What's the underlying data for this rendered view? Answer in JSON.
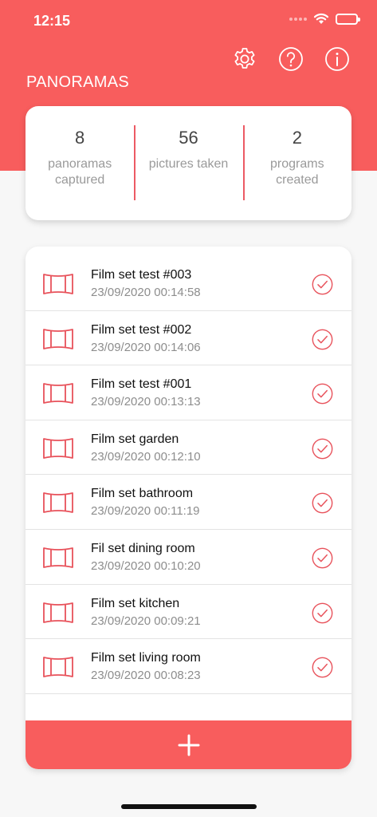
{
  "status_bar": {
    "time": "12:15"
  },
  "header": {
    "title": "PANORAMAS",
    "actions": [
      {
        "name": "settings-icon"
      },
      {
        "name": "help-icon"
      },
      {
        "name": "info-icon"
      }
    ]
  },
  "stats": [
    {
      "value": "8",
      "label": "panoramas captured"
    },
    {
      "value": "56",
      "label": "pictures taken"
    },
    {
      "value": "2",
      "label": "programs created"
    }
  ],
  "panoramas": [
    {
      "title": "Film set test #003",
      "date": "23/09/2020 00:14:58",
      "status": "check"
    },
    {
      "title": "Film set test #002",
      "date": "23/09/2020 00:14:06",
      "status": "check"
    },
    {
      "title": "Film set test #001",
      "date": "23/09/2020 00:13:13",
      "status": "check"
    },
    {
      "title": "Film set garden",
      "date": "23/09/2020 00:12:10",
      "status": "check"
    },
    {
      "title": "Film set bathroom",
      "date": "23/09/2020 00:11:19",
      "status": "check"
    },
    {
      "title": "Fil set dining room",
      "date": "23/09/2020 00:10:20",
      "status": "check"
    },
    {
      "title": "Film set kitchen",
      "date": "23/09/2020 00:09:21",
      "status": "check"
    },
    {
      "title": "Film set living room",
      "date": "23/09/2020 00:08:23",
      "status": "check"
    }
  ],
  "add_button": {
    "icon": "plus-icon"
  },
  "colors": {
    "accent": "#f85d5d",
    "divider": "#ec5a64",
    "background": "#f7f7f7"
  }
}
